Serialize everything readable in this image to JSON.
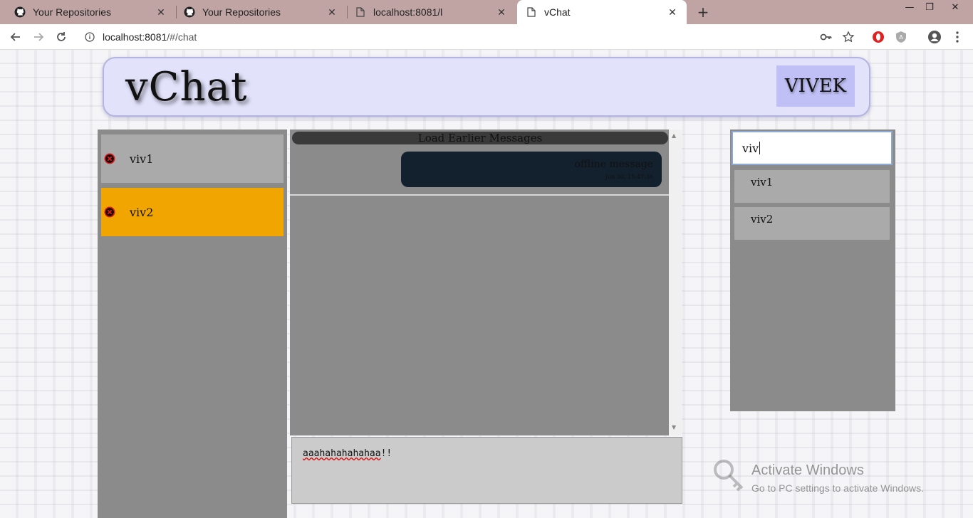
{
  "browser": {
    "tabs": [
      {
        "title": "Your Repositories",
        "icon": "github-icon",
        "active": false
      },
      {
        "title": "Your Repositories",
        "icon": "github-icon",
        "active": false
      },
      {
        "title": "localhost:8081/l",
        "icon": "page-icon",
        "active": false
      },
      {
        "title": "vChat",
        "icon": "page-icon",
        "active": true
      }
    ],
    "new_tab_label": "+",
    "window_controls": {
      "minimize": "—",
      "restore": "❐",
      "close": "✕"
    },
    "url_host": "localhost:8081",
    "url_path": "/#/chat"
  },
  "app": {
    "logo": "vChat",
    "user": "VIVEK"
  },
  "contacts": [
    {
      "name": "viv1",
      "selected": false
    },
    {
      "name": "viv2",
      "selected": true
    }
  ],
  "chat": {
    "load_earlier": "Load Earlier Messages",
    "messages": [
      {
        "text": "offline message",
        "time": "Jun 30, 15:47:36"
      }
    ],
    "composer_text": "aaahahahahahaa",
    "composer_suffix": "!!"
  },
  "search": {
    "value": "viv",
    "results": [
      "viv1",
      "viv2"
    ]
  },
  "watermark": {
    "title": "Activate Windows",
    "subtitle": "Go to PC settings to activate Windows."
  },
  "colors": {
    "selected_contact": "#f0a500",
    "contact": "#aaaaaa",
    "panel": "#8b8b8b",
    "bubble": "#13202e",
    "header": "#e2e2fb",
    "user_badge": "#c0c0f6"
  }
}
